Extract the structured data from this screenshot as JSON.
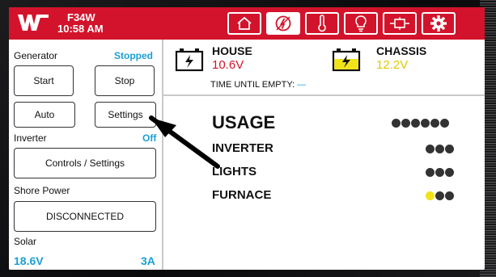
{
  "header": {
    "model": "F34W",
    "time": "10:58 AM",
    "tabs": [
      {
        "name": "home-icon",
        "active": false
      },
      {
        "name": "generator-icon",
        "active": true
      },
      {
        "name": "thermometer-icon",
        "active": false
      },
      {
        "name": "lightbulb-icon",
        "active": false
      },
      {
        "name": "plug-icon",
        "active": false
      },
      {
        "name": "gear-icon",
        "active": false
      }
    ]
  },
  "generator": {
    "label": "Generator",
    "status": "Stopped",
    "start_label": "Start",
    "stop_label": "Stop",
    "auto_label": "Auto",
    "settings_label": "Settings"
  },
  "inverter": {
    "label": "Inverter",
    "status": "Off",
    "controls_label": "Controls / Settings"
  },
  "shore_power": {
    "label": "Shore Power",
    "status_button": "DISCONNECTED"
  },
  "solar": {
    "label": "Solar",
    "voltage": "18.6V",
    "current": "3A"
  },
  "batteries": {
    "house": {
      "name": "HOUSE",
      "voltage": "10.6V",
      "color": "#d3132b"
    },
    "chassis": {
      "name": "CHASSIS",
      "voltage": "12.2V",
      "color": "#e0c800"
    },
    "time_until_empty_label": "TIME UNTIL EMPTY:",
    "time_until_empty_value": "—"
  },
  "usage": {
    "title": "USAGE",
    "title_dots": 6,
    "items": [
      {
        "label": "INVERTER",
        "active_dots": 0,
        "dots": 3
      },
      {
        "label": "LIGHTS",
        "active_dots": 0,
        "dots": 3
      },
      {
        "label": "FURNACE",
        "active_dots": 1,
        "dots": 3
      }
    ]
  },
  "colors": {
    "accent_red": "#d3132b",
    "status_blue": "#1a9fd6",
    "dot_active": "#f2e21a",
    "dot_inactive": "#333333"
  }
}
